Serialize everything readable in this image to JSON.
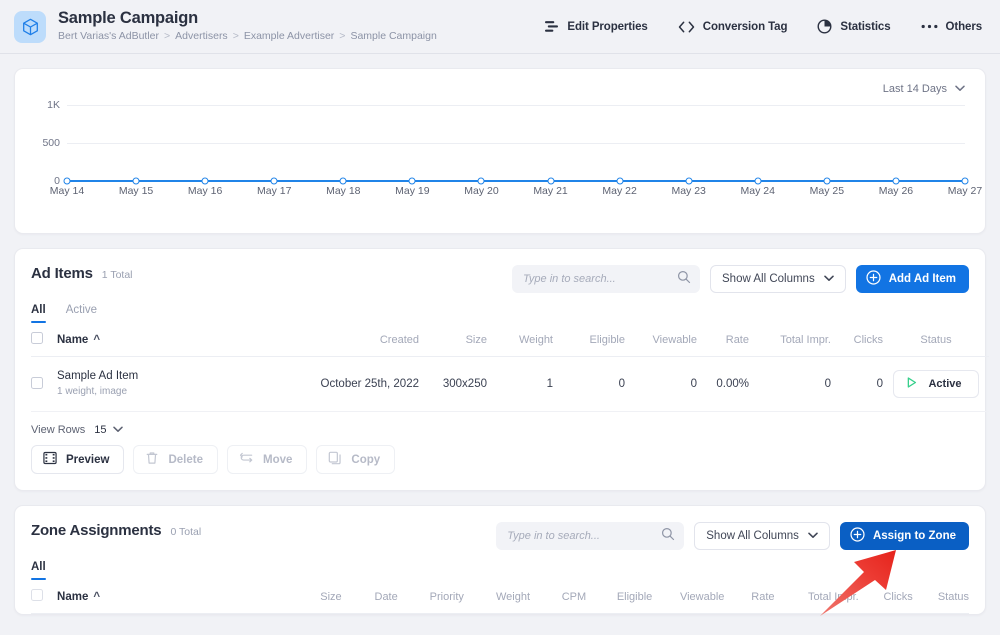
{
  "header": {
    "app_icon": "cube-icon",
    "title": "Sample Campaign",
    "breadcrumb": [
      "Bert Varias's AdButler",
      "Advertisers",
      "Example Advertiser",
      "Sample Campaign"
    ],
    "breadcrumb_separator": ">",
    "nav": [
      {
        "label": "Edit Properties",
        "icon": "sliders-icon"
      },
      {
        "label": "Conversion Tag",
        "icon": "code-brackets-icon"
      },
      {
        "label": "Statistics",
        "icon": "pie-chart-icon"
      },
      {
        "label": "Others",
        "icon": "ellipsis-icon"
      }
    ]
  },
  "chart_card": {
    "range_label": "Last 14 Days",
    "range_icon": "chevron-down-icon"
  },
  "chart_data": {
    "type": "line",
    "title": "",
    "xlabel": "",
    "ylabel": "",
    "categories": [
      "May 14",
      "May 15",
      "May 16",
      "May 17",
      "May 18",
      "May 19",
      "May 20",
      "May 21",
      "May 22",
      "May 23",
      "May 24",
      "May 25",
      "May 26",
      "May 27"
    ],
    "values": [
      0,
      0,
      0,
      0,
      0,
      0,
      0,
      0,
      0,
      0,
      0,
      0,
      0,
      0
    ],
    "ytick_labels": [
      "1K",
      "500",
      "0"
    ],
    "ytick_values": [
      1000,
      500,
      0
    ],
    "ylim": [
      0,
      1000
    ],
    "grid": true,
    "legend": false,
    "series_color": "#2084e8",
    "marker": "open-circle"
  },
  "ad_items": {
    "title": "Ad Items",
    "total": "1 Total",
    "search_placeholder": "Type in to search...",
    "search_value": "",
    "search_icon": "search-icon",
    "columns_button": "Show All Columns",
    "columns_icon": "chevron-down-icon",
    "add_button": "Add Ad Item",
    "add_icon": "plus-circle-icon",
    "tabs": [
      {
        "label": "All",
        "active": true
      },
      {
        "label": "Active",
        "active": false
      }
    ],
    "headers": [
      "Name",
      "Created",
      "Size",
      "Weight",
      "Eligible",
      "Viewable",
      "Rate",
      "Total Impr.",
      "Clicks",
      "Status"
    ],
    "sort_column": "Name",
    "sort_icon": "caret-up-icon",
    "rows": [
      {
        "name": "Sample Ad Item",
        "sub": "1 weight, image",
        "created": "October 25th, 2022",
        "size": "300x250",
        "weight": "1",
        "eligible": "0",
        "viewable": "0",
        "rate": "0.00%",
        "total_impr": "0",
        "clicks": "0",
        "status": "Active",
        "status_icon": "play-triangle-icon"
      }
    ],
    "view_rows_label": "View Rows",
    "view_rows_value": "15",
    "view_rows_icon": "chevron-down-icon",
    "actions": [
      {
        "label": "Preview",
        "icon": "film-icon",
        "disabled": false
      },
      {
        "label": "Delete",
        "icon": "trash-icon",
        "disabled": true
      },
      {
        "label": "Move",
        "icon": "move-arrows-icon",
        "disabled": true
      },
      {
        "label": "Copy",
        "icon": "copy-icon",
        "disabled": true
      }
    ]
  },
  "zone_assignments": {
    "title": "Zone Assignments",
    "total": "0 Total",
    "search_placeholder": "Type in to search...",
    "search_value": "",
    "search_icon": "search-icon",
    "columns_button": "Show All Columns",
    "columns_icon": "chevron-down-icon",
    "assign_button": "Assign to Zone",
    "assign_icon": "plus-circle-icon",
    "tabs": [
      {
        "label": "All",
        "active": true
      }
    ],
    "headers": [
      "Name",
      "Size",
      "Date",
      "Priority",
      "Weight",
      "CPM",
      "Eligible",
      "Viewable",
      "Rate",
      "Total Impr.",
      "Clicks",
      "Status"
    ],
    "sort_column": "Name",
    "sort_icon": "caret-up-icon",
    "rows": []
  },
  "annotation": {
    "arrow_icon": "red-arrow-pointing-up-right",
    "arrow_color": "#ea2a24",
    "points_at": "Assign to Zone"
  },
  "colors": {
    "page_bg": "#f1f2f6",
    "accent": "#1274e3",
    "accent_pressed": "#0a5fc4",
    "text": "#2b3141",
    "muted": "#9aa0b1",
    "status_green": "#36cf8b",
    "annotation_red": "#ea2a24"
  }
}
